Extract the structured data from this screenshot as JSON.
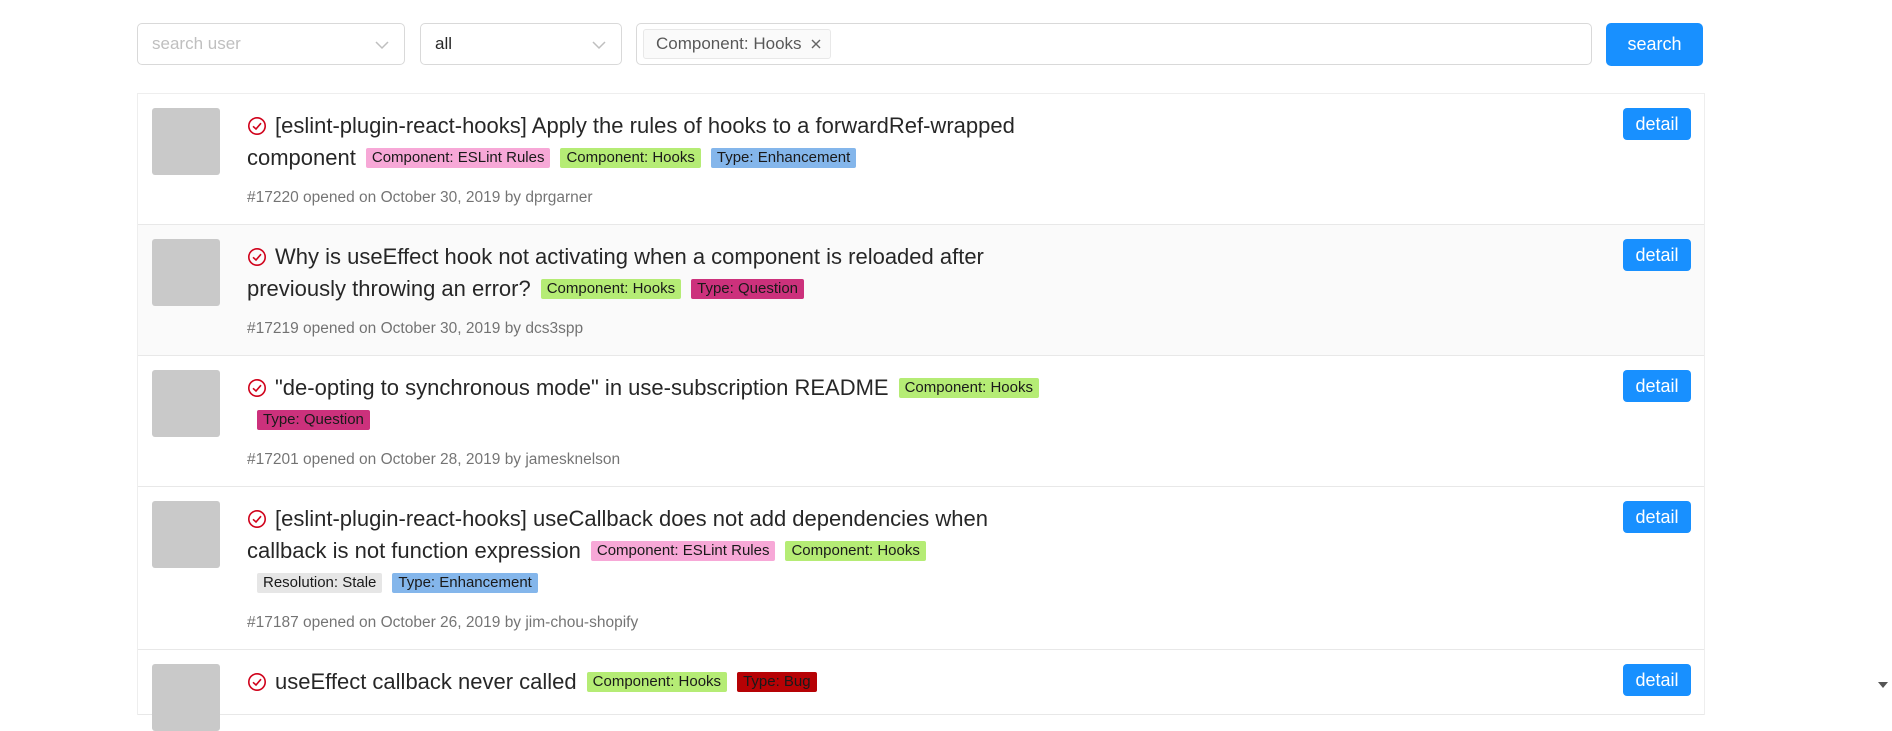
{
  "filters": {
    "user_placeholder": "search user",
    "state_value": "all",
    "labels": [
      "Component: Hooks"
    ],
    "search_label": "search"
  },
  "colors": {
    "accent": "#1890ff",
    "Component: ESLint Rules": "#f7a8d7",
    "Component: Hooks": "#b5ec75",
    "Type: Enhancement": "#84b6eb",
    "Type: Question": "#cc317c",
    "Resolution: Stale": "#e6e6e6",
    "Type: Bug": "#b60205",
    "status_icon": "#d0021b"
  },
  "issues": [
    {
      "title": "[eslint-plugin-react-hooks] Apply the rules of hooks to a forwardRef-wrapped component",
      "labels": [
        "Component: ESLint Rules",
        "Component: Hooks",
        "Type: Enhancement"
      ],
      "meta": "#17220 opened on October 30, 2019 by dprgarner",
      "detail_label": "detail",
      "status_icon": "issue-closed-icon"
    },
    {
      "title": "Why is useEffect hook not activating when a component is reloaded after previously throwing an error?",
      "labels": [
        "Component: Hooks",
        "Type: Question"
      ],
      "meta": "#17219 opened on October 30, 2019 by dcs3spp",
      "detail_label": "detail",
      "status_icon": "issue-closed-icon"
    },
    {
      "title": "\"de-opting to synchronous mode\" in use-subscription README",
      "labels": [
        "Component: Hooks",
        "Type: Question"
      ],
      "meta": "#17201 opened on October 28, 2019 by jamesknelson",
      "detail_label": "detail",
      "status_icon": "issue-closed-icon"
    },
    {
      "title": "[eslint-plugin-react-hooks] useCallback does not add dependencies when callback is not function expression",
      "labels": [
        "Component: ESLint Rules",
        "Component: Hooks",
        "Resolution: Stale",
        "Type: Enhancement"
      ],
      "meta": "#17187 opened on October 26, 2019 by jim-chou-shopify",
      "detail_label": "detail",
      "status_icon": "issue-closed-icon"
    },
    {
      "title": "useEffect callback never called",
      "labels": [
        "Component: Hooks",
        "Type: Bug"
      ],
      "meta": "",
      "detail_label": "detail",
      "status_icon": "issue-closed-icon"
    }
  ]
}
